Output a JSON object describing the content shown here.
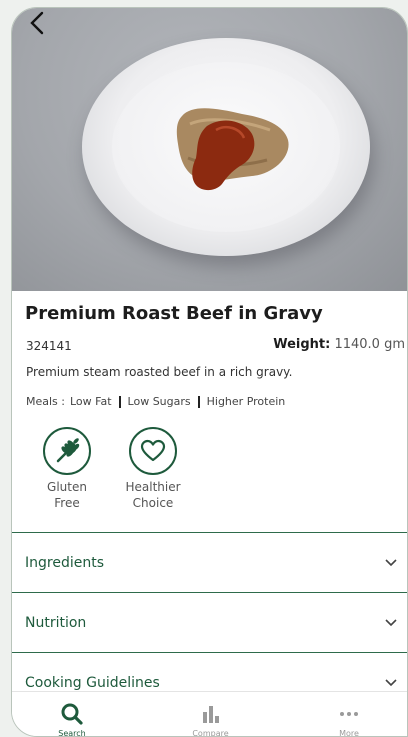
{
  "product": {
    "title": "Premium Roast Beef in Gravy",
    "code": "324141",
    "weight_label": "Weight:",
    "weight_value": "1140.0 gm",
    "description": "Premium steam roasted beef in a rich gravy.",
    "meals_label": "Meals :",
    "meals": [
      "Low Fat",
      "Low Sugars",
      "Higher Protein"
    ]
  },
  "badges": [
    {
      "icon": "wheat-icon",
      "line1": "Gluten",
      "line2": "Free"
    },
    {
      "icon": "heart-icon",
      "line1": "Healthier",
      "line2": "Choice"
    }
  ],
  "sections": [
    "Ingredients",
    "Nutrition",
    "Cooking Guidelines"
  ],
  "tabs": [
    {
      "label": "Search",
      "icon": "search-icon"
    },
    {
      "label": "Compare",
      "icon": "bar-chart-icon"
    },
    {
      "label": "More",
      "icon": "more-dots-icon"
    }
  ],
  "colors": {
    "accent": "#1e5a3c",
    "gravy": "#8c2a10"
  }
}
